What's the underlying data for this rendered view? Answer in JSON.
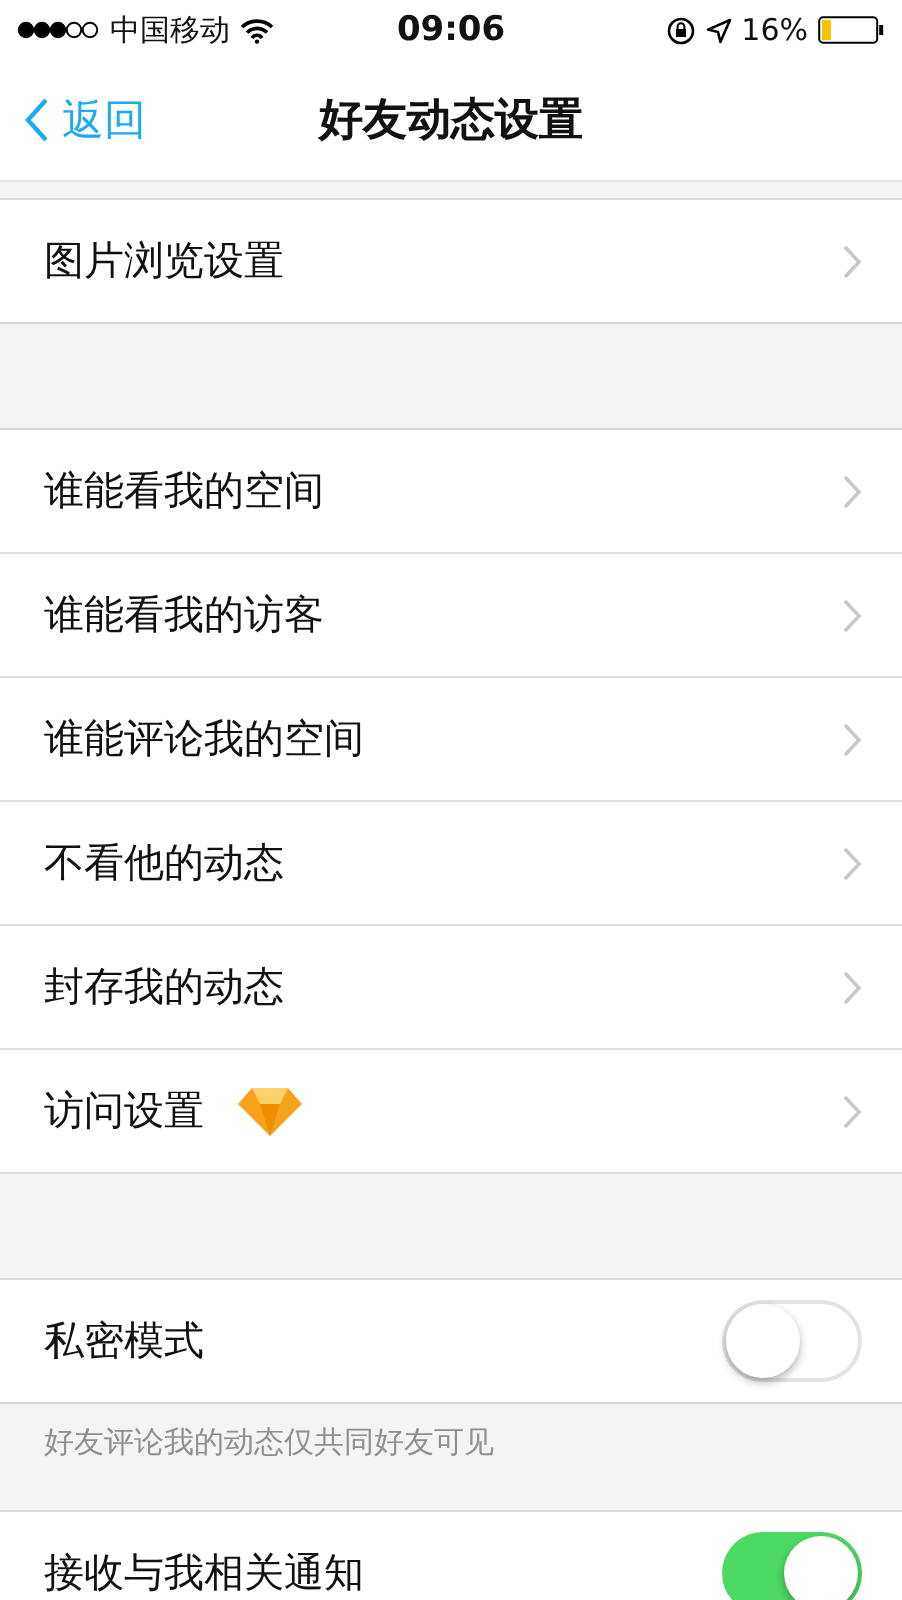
{
  "status_bar": {
    "carrier": "中国移动",
    "time": "09:06",
    "battery": "16%"
  },
  "nav": {
    "back": "返回",
    "title": "好友动态设置"
  },
  "sections": [
    {
      "rows": [
        {
          "kind": "link",
          "label": "图片浏览设置",
          "badge": false
        }
      ]
    },
    {
      "rows": [
        {
          "kind": "link",
          "label": "谁能看我的空间",
          "badge": false
        },
        {
          "kind": "link",
          "label": "谁能看我的访客",
          "badge": false
        },
        {
          "kind": "link",
          "label": "谁能评论我的空间",
          "badge": false
        },
        {
          "kind": "link",
          "label": "不看他的动态",
          "badge": false
        },
        {
          "kind": "link",
          "label": "封存我的动态",
          "badge": false
        },
        {
          "kind": "link",
          "label": "访问设置",
          "badge": true
        }
      ]
    },
    {
      "rows": [
        {
          "kind": "toggle",
          "label": "私密模式",
          "on": false
        }
      ],
      "footer": "好友评论我的动态仅共同好友可见"
    },
    {
      "rows": [
        {
          "kind": "toggle",
          "label": "接收与我相关通知",
          "on": true
        }
      ]
    }
  ]
}
